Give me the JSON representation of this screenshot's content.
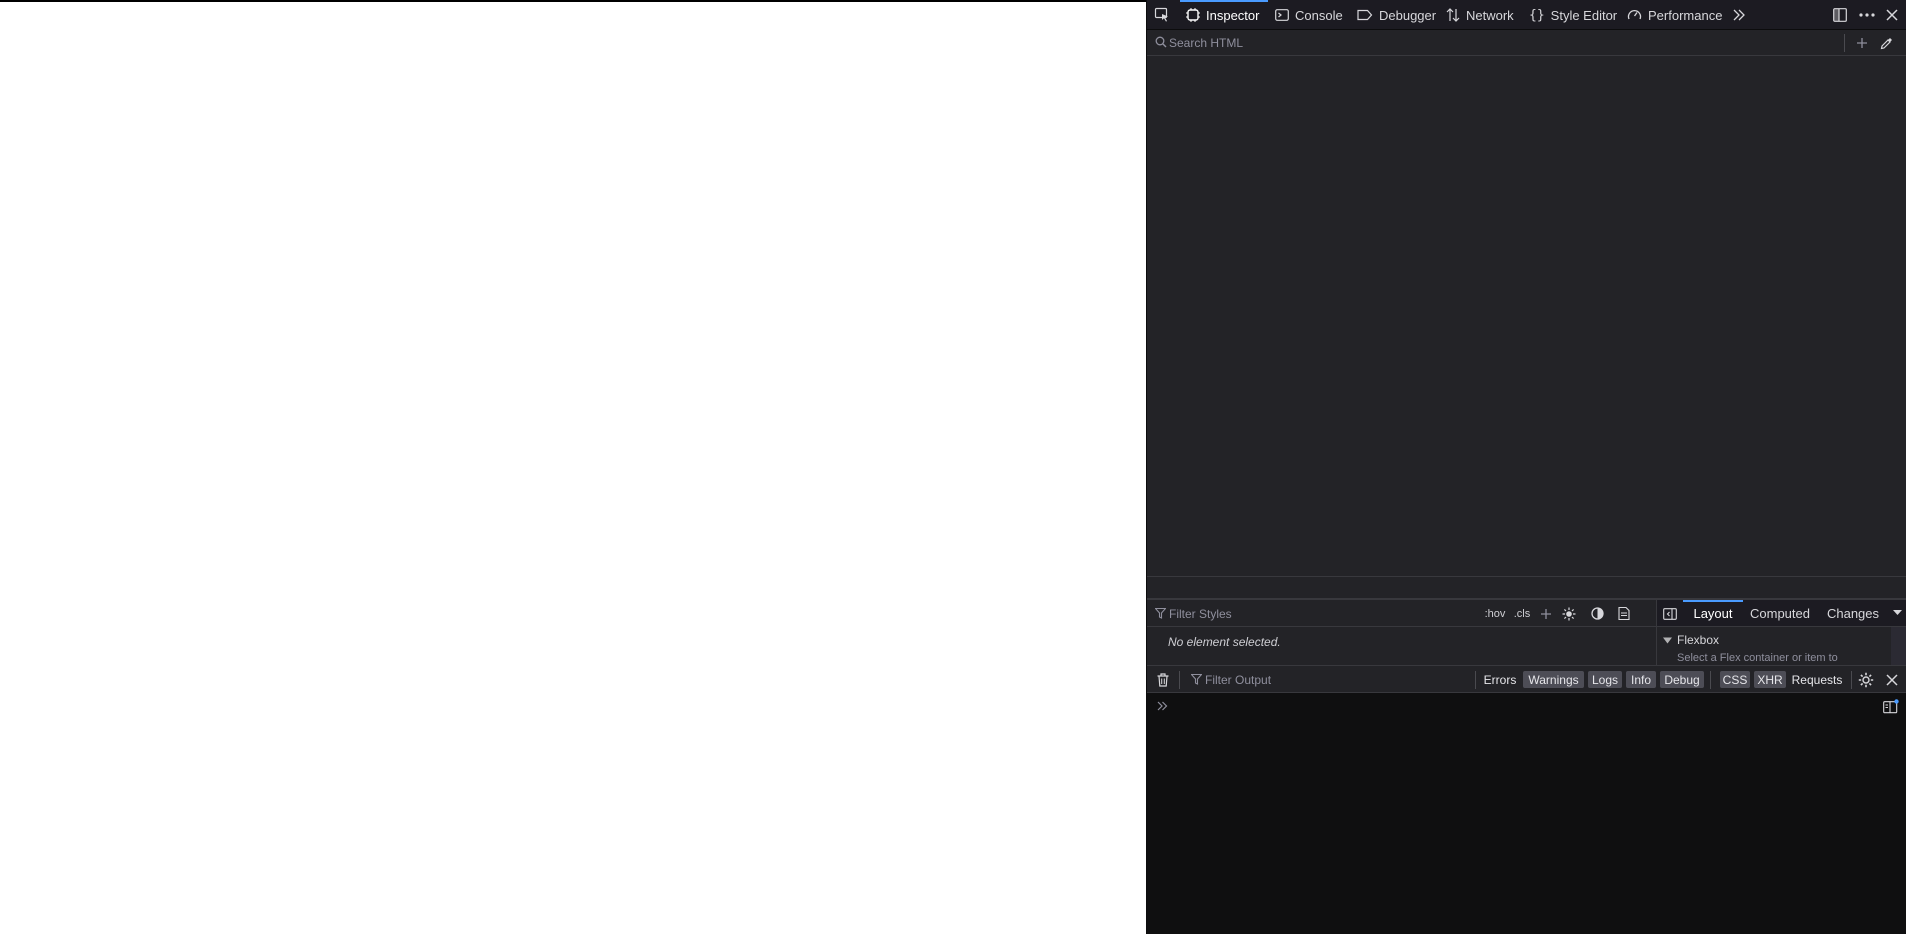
{
  "colors": {
    "page_bg": "#ffffff",
    "toolbar_bg": "#1c1b22",
    "panel_bg": "#232327",
    "console_bg": "#0f0f10",
    "accent": "#4a9bff",
    "text": "#d7d7db",
    "placeholder": "#8f8f9d"
  },
  "toolbar": {
    "picker_icon": "element-picker-icon",
    "tabs": [
      {
        "label": "Inspector",
        "icon": "inspector-icon",
        "active": true
      },
      {
        "label": "Console",
        "icon": "console-icon",
        "active": false
      },
      {
        "label": "Debugger",
        "icon": "debugger-icon",
        "active": false
      },
      {
        "label": "Network",
        "icon": "network-icon",
        "active": false
      },
      {
        "label": "Style Editor",
        "icon": "style-editor-icon",
        "active": false
      },
      {
        "label": "Performance",
        "icon": "performance-icon",
        "active": false
      }
    ],
    "right_icons": [
      "overflow-chevron-icon",
      "dock-side-icon",
      "more-options-icon",
      "close-icon"
    ]
  },
  "inspector": {
    "search_placeholder": "Search HTML",
    "search_icons": [
      "search-icon",
      "add-node-icon",
      "eyedropper-icon"
    ]
  },
  "rules": {
    "filter_placeholder": "Filter Styles",
    "hov_label": ":hov",
    "cls_label": ".cls",
    "empty_message": "No element selected."
  },
  "sidebar": {
    "tabs": [
      {
        "label": "Layout",
        "active": true
      },
      {
        "label": "Computed",
        "active": false
      },
      {
        "label": "Changes",
        "active": false
      }
    ],
    "flexbox_label": "Flexbox",
    "flexbox_sub": "Select a Flex container or item to"
  },
  "console": {
    "filter_placeholder": "Filter Output",
    "levels": [
      {
        "label": "Errors",
        "on": false
      },
      {
        "label": "Warnings",
        "on": true
      },
      {
        "label": "Logs",
        "on": true
      },
      {
        "label": "Info",
        "on": true
      },
      {
        "label": "Debug",
        "on": true
      }
    ],
    "types": [
      {
        "label": "CSS",
        "on": true
      },
      {
        "label": "XHR",
        "on": true
      },
      {
        "label": "Requests",
        "on": false
      }
    ]
  }
}
